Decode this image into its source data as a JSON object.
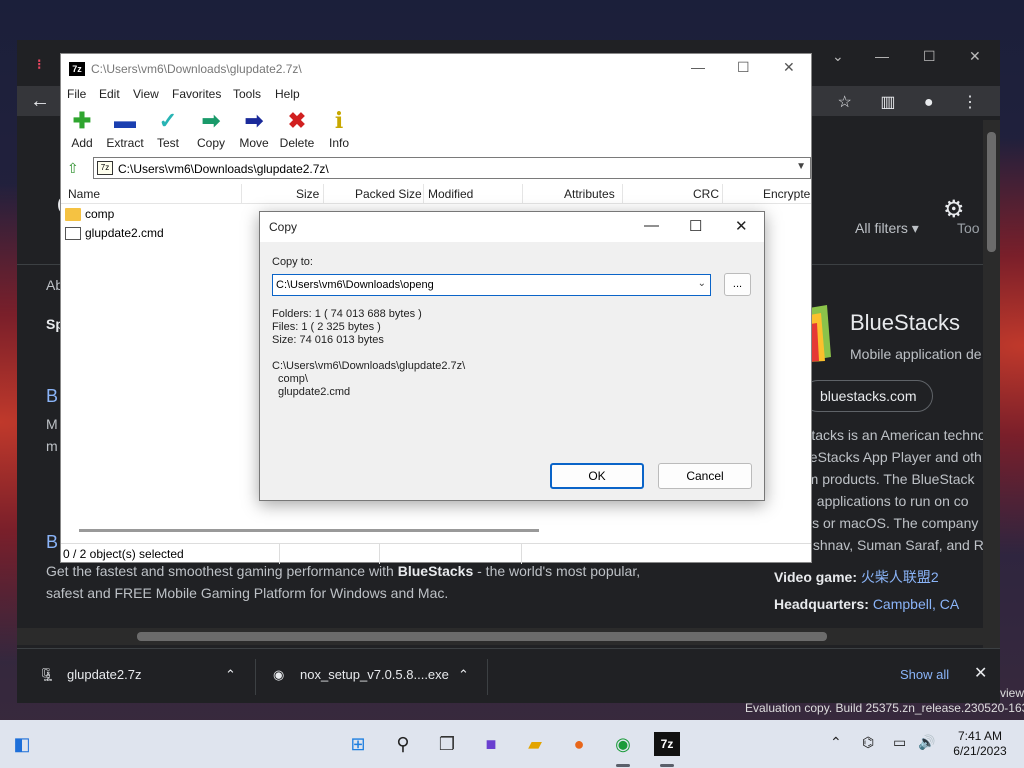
{
  "sevenzip": {
    "title": "C:\\Users\\vm6\\Downloads\\glupdate2.7z\\",
    "app_icon_text": "7z",
    "menu": [
      "File",
      "Edit",
      "View",
      "Favorites",
      "Tools",
      "Help"
    ],
    "toolbar": [
      {
        "label": "Add",
        "icon": "plus-icon",
        "glyph": "✚",
        "color": "#2fa52f"
      },
      {
        "label": "Extract",
        "icon": "minus-icon",
        "glyph": "▬",
        "color": "#1a3fb0"
      },
      {
        "label": "Test",
        "icon": "check-icon",
        "glyph": "✓",
        "color": "#28b4b4"
      },
      {
        "label": "Copy",
        "icon": "copy-arrow-icon",
        "glyph": "➡",
        "color": "#1a9a6a"
      },
      {
        "label": "Move",
        "icon": "move-arrow-icon",
        "glyph": "➡",
        "color": "#1a2a9a"
      },
      {
        "label": "Delete",
        "icon": "delete-x-icon",
        "glyph": "✖",
        "color": "#d12020"
      },
      {
        "label": "Info",
        "icon": "info-icon",
        "glyph": "i",
        "color": "#c8a800"
      }
    ],
    "address": "C:\\Users\\vm6\\Downloads\\glupdate2.7z\\",
    "columns": [
      "Name",
      "Size",
      "Packed Size",
      "Modified",
      "Attributes",
      "CRC",
      "Encrypte"
    ],
    "files": [
      {
        "name": "comp",
        "type": "folder"
      },
      {
        "name": "glupdate2.cmd",
        "type": "file"
      }
    ],
    "status": "0 / 2 object(s) selected"
  },
  "copy_dialog": {
    "title": "Copy",
    "copy_to_label": "Copy to:",
    "destination": "C:\\Users\\vm6\\Downloads\\openg",
    "browse_label": "...",
    "folders_line": "Folders: 1    ( 74 013 688 bytes )",
    "files_line": "Files: 1    ( 2 325 bytes )",
    "size_line": "Size: 74 016 013 bytes",
    "source_path": "C:\\Users\\vm6\\Downloads\\glupdate2.7z\\",
    "source_items": [
      "comp\\",
      "glupdate2.cmd"
    ],
    "ok_label": "OK",
    "cancel_label": "Cancel"
  },
  "browser": {
    "filters_label": "All filters ▾",
    "tools_label": "Too",
    "left_fragments": [
      "Ab",
      "Sp",
      "B",
      "M",
      "m",
      "B"
    ],
    "snippet_prefix": "Get the fastest and smoothest gaming performance with ",
    "snippet_bold": "BlueStacks",
    "snippet_suffix": " - the world's most popular, safest and FREE Mobile Gaming Platform for Windows and Mac.",
    "kp_title": "BlueStacks",
    "kp_subtitle": "Mobile application de",
    "kp_chip": "bluestacks.com",
    "kp_desc": [
      "Stacks is an American techno",
      "ueStacks App Player and oth",
      "rm products. The BlueStack",
      "id applications to run on co",
      "ws or macOS. The company",
      "aishnav, Suman Saraf, and R"
    ],
    "facts": [
      {
        "label": "Video game: ",
        "value": "火柴人联盟2"
      },
      {
        "label": "Headquarters: ",
        "value": "Campbell, CA"
      }
    ],
    "downloads": [
      {
        "name": "glupdate2.7z"
      },
      {
        "name": "nox_setup_v7.0.5.8....exe"
      }
    ],
    "show_all": "Show all"
  },
  "watermark": "Evaluation copy. Build 25375.zn_release.230520-1632",
  "watermark2": "view",
  "taskbar": {
    "time": "7:41 AM",
    "date": "6/21/2023"
  }
}
